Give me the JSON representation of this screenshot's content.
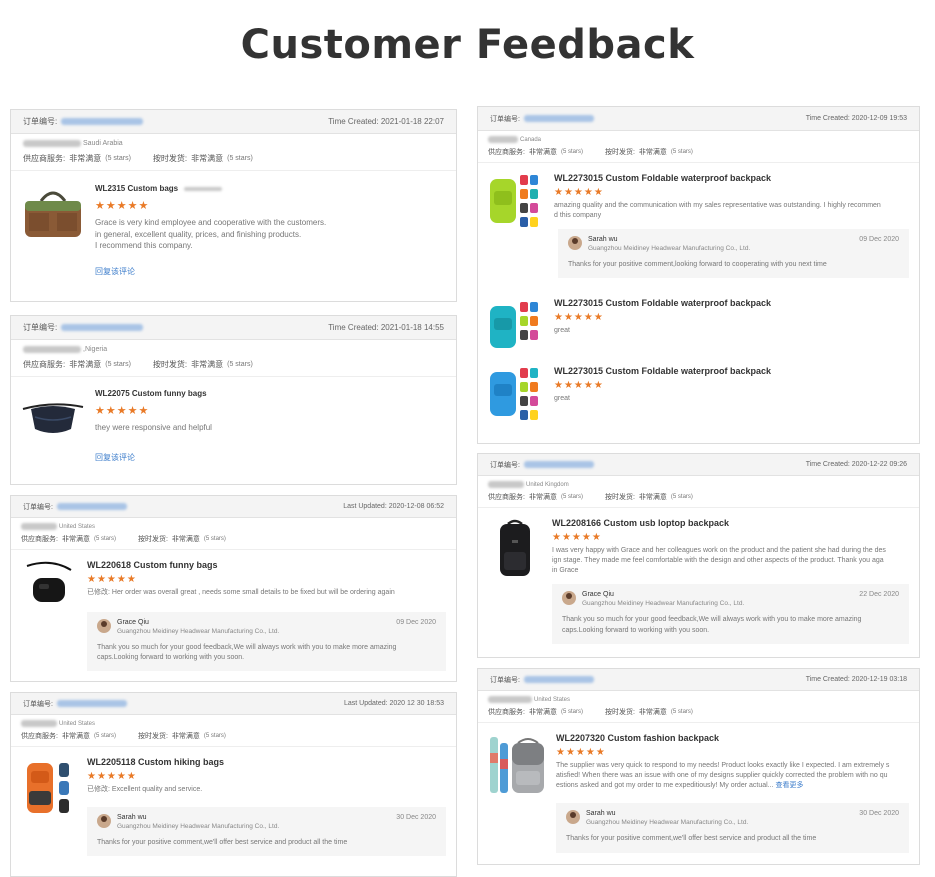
{
  "page": {
    "title": "Customer Feedback"
  },
  "labels": {
    "order_no": "订单编号:",
    "supplier_service": "供应商服务:",
    "delivery": "按时发货:",
    "very_satisfied": "非常满意",
    "five_stars": "(5 stars)",
    "reply_link": "回复该评论",
    "reply_prefix": "已修改:",
    "see_more": "查看更多"
  },
  "cards": {
    "c1": {
      "time": "Time Created: 2021-01-18 22:07",
      "location": "Saudi Arabia",
      "item": {
        "title": "WL2315 Custom bags",
        "stars": "★★★★★",
        "review": "Grace is very kind employee and cooperative with the customers.\nin general, excellent quality, prices, and finishing products.\nI recommend this company."
      }
    },
    "c2": {
      "time": "Time Created: 2021-01-18 14:55",
      "location": ",Nigeria",
      "item": {
        "title": "WL22075 Custom funny bags",
        "stars": "★★★★★",
        "review": "they were responsive and helpful"
      }
    },
    "c3": {
      "time": "Last Updated: 2020-12-08 06:52",
      "location": "United States",
      "item": {
        "title": "WL220618 Custom funny bags",
        "stars": "★★★★★",
        "review": "Her order was overall great , needs some small details to be fixed but will be ordering again"
      },
      "reply": {
        "name": "Grace Qiu",
        "company": "Guangzhou Meidiney Headwear Manufacturing Co., Ltd.",
        "date": "09 Dec 2020",
        "text": "Thank you so much for your good feedback,We will always work with you to make more amazing caps.Looking forward to working with you soon."
      }
    },
    "c4": {
      "time": "Last Updated: 2020 12 30 18:53",
      "location": "United States",
      "item": {
        "title": "WL2205118 Custom hiking bags",
        "stars": "★★★★★",
        "review": "Excellent quality and service."
      },
      "reply": {
        "name": "Sarah wu",
        "company": "Guangzhou Meidiney Headwear Manufacturing Co., Ltd.",
        "date": "30 Dec 2020",
        "text": "Thanks for your positive comment,we'll offer best service and product all the time"
      }
    },
    "c5": {
      "time": "Time Created: 2020-12-09 19:53",
      "location": "Canada",
      "items": [
        {
          "title": "WL2273015 Custom Foldable waterproof backpack",
          "stars": "★★★★★",
          "review": "amazing quality and the communication with my sales representative was outstanding. I highly recommen\nd this company"
        },
        {
          "title": "WL2273015 Custom Foldable waterproof backpack",
          "stars": "★★★★★",
          "review": "great"
        },
        {
          "title": "WL2273015 Custom Foldable waterproof backpack",
          "stars": "★★★★★",
          "review": "great"
        }
      ],
      "reply": {
        "name": "Sarah wu",
        "company": "Guangzhou Meidiney Headwear Manufacturing Co., Ltd.",
        "date": "09 Dec 2020",
        "text": "Thanks for your positive comment,looking forward to cooperating with you next time"
      }
    },
    "c6": {
      "time": "Time Created: 2020-12-22 09:26",
      "location": "United Kingdom",
      "item": {
        "title": "WL2208166 Custom usb loptop backpack",
        "stars": "★★★★★",
        "review": "I was very happy with Grace and her colleagues work on the product and the patient she had during the des\nign stage. They made me feel comfortable with the design and other aspects of the product. Thank you aga\nin Grace"
      },
      "reply": {
        "name": "Grace Qiu",
        "company": "Guangzhou Meidiney Headwear Manufacturing Co., Ltd.",
        "date": "22 Dec 2020",
        "text": "Thank you so much for your good feedback,We will always work with you to make more amazing\ncaps.Looking forward to working with you soon."
      }
    },
    "c7": {
      "time": "Time Created: 2020-12-19 03:18",
      "location": "United States",
      "item": {
        "title": "WL2207320 Custom fashion backpack",
        "stars": "★★★★★",
        "review": "The supplier was very quick to respond to my needs! Product looks exactly like I expected. I am extremely s\natisfied! When there was an issue with one of my designs supplier quickly corrected the problem with no qu\nestions asked and got my order to me expeditiously! My order actual..."
      },
      "reply": {
        "name": "Sarah wu",
        "company": "Guangzhou Meidiney Headwear Manufacturing Co., Ltd.",
        "date": "30 Dec 2020",
        "text": "Thanks for your positive comment,we'll offer best service and product all the time"
      }
    }
  }
}
